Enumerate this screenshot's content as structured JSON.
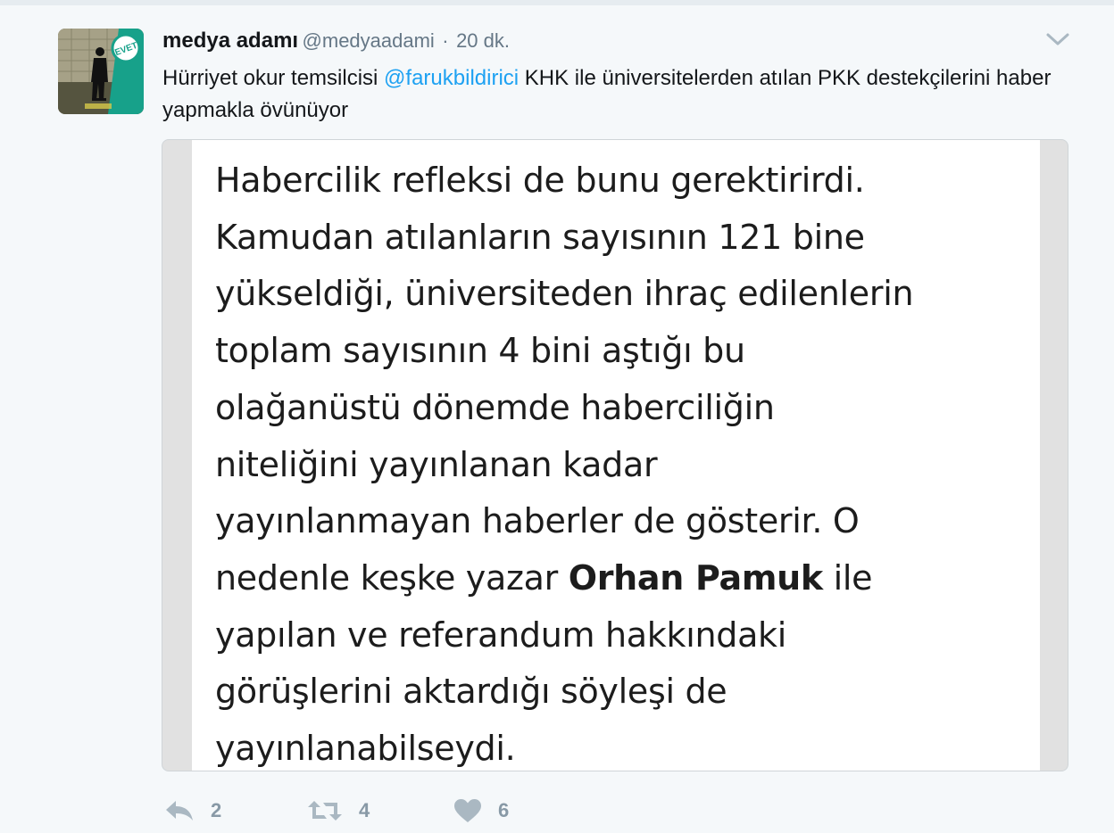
{
  "tweet": {
    "author_name": "medya adamı",
    "handle": "@medyaadami",
    "separator": "·",
    "time": "20 dk.",
    "text_before": "Hürriyet okur temsilcisi ",
    "mention": "@farukbildirici",
    "text_after": " KHK ile üniversitelerden atılan PKK destekçilerini haber yapmakla övünüyor"
  },
  "avatar": {
    "badge_text": "EVET"
  },
  "media": {
    "lines": [
      "Habercilik refleksi de bunu gerektirirdi.",
      "Kamudan atılanların sayısının 121 bine",
      "yükseldiği, üniversiteden ihraç edilenlerin",
      "toplam sayısının 4 bini aştığı bu",
      "olağanüstü dönemde haberciliğin",
      "niteliğini yayınlanan kadar",
      "yayınlanmayan haberler de gösterir. O"
    ],
    "line8_before": "nedenle keşke yazar ",
    "line8_bold": "Orhan Pamuk",
    "line8_after": " ile",
    "lines_end": [
      "yapılan ve referandum hakkındaki",
      "görüşlerini aktardığı söyleşi de",
      "yayınlanabilseydi."
    ]
  },
  "actions": {
    "reply_count": "2",
    "retweet_count": "4",
    "like_count": "6"
  },
  "icons": {
    "reply": "reply-icon",
    "retweet": "retweet-icon",
    "like": "heart-icon",
    "caret": "chevron-down-icon"
  },
  "colors": {
    "mention": "#1da1f2",
    "muted": "#657786",
    "action_icon": "#aab8c2",
    "background": "#f5f8fa"
  }
}
